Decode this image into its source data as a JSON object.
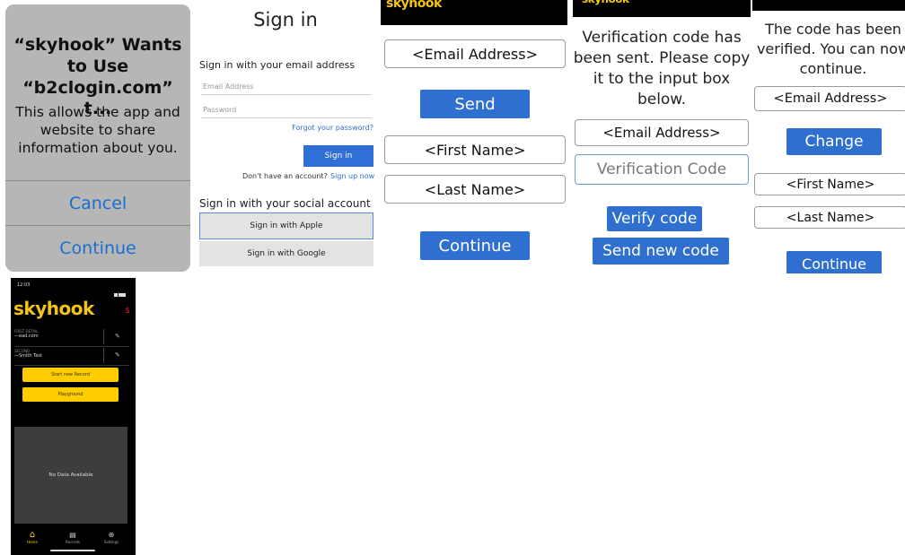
{
  "alert": {
    "title_line1": "“skyhook” Wants",
    "title_line2": "to Use",
    "title_line3": "“b2clogin.com” t...",
    "message_line1": "This allows the app and",
    "message_line2": "website to share",
    "message_line3": "information about you.",
    "cancel_label": "Cancel",
    "continue_label": "Continue"
  },
  "signin": {
    "heading": "Sign in",
    "email_section": "Sign in with your email address",
    "email_placeholder": "Email Address",
    "password_placeholder": "Password",
    "forgot_link": "Forgot your password?",
    "signin_button": "Sign in",
    "no_account": "Don't have an account?",
    "signup_link": "Sign up now",
    "social_section": "Sign in with your social account",
    "apple_button": "Sign in with Apple",
    "google_button": "Sign in with Google"
  },
  "signup_form": {
    "email_field": "<Email Address>",
    "send_button": "Send",
    "first_name_field": "<First Name>",
    "last_name_field": "<Last Name>",
    "continue_button": "Continue"
  },
  "verification": {
    "message_line1": "Verification code has",
    "message_line2": "been sent. Please copy",
    "message_line3": "it to the input box",
    "message_line4": "below.",
    "email_field": "<Email Address>",
    "code_placeholder": "Verification Code",
    "verify_button": "Verify code",
    "resend_button": "Send new code"
  },
  "verified": {
    "message_line1": "The code has been",
    "message_line2": "verified. You can now",
    "message_line3": "continue.",
    "email_field": "<Email Address>",
    "change_button": "Change",
    "first_name_field": "<First Name>",
    "last_name_field": "<Last Name>",
    "continue_button": "Continue"
  },
  "brand": {
    "logo_text": "skyhook",
    "yellow": "#ffcc00",
    "blue": "#2e6fd0"
  },
  "phone": {
    "time": "12:03",
    "row1_label": "FIRST DETAIL",
    "row1_value": "—ead.com",
    "row2_label": "SECOND",
    "row2_value": "—Smith Test",
    "button1": "Start new Record",
    "button2": "Playground",
    "empty_text": "No Data Available",
    "tab_home": "Home",
    "tab_records": "Records",
    "tab_settings": "Settings",
    "tab_icons": [
      "home-icon",
      "records-icon",
      "settings-icon"
    ]
  }
}
